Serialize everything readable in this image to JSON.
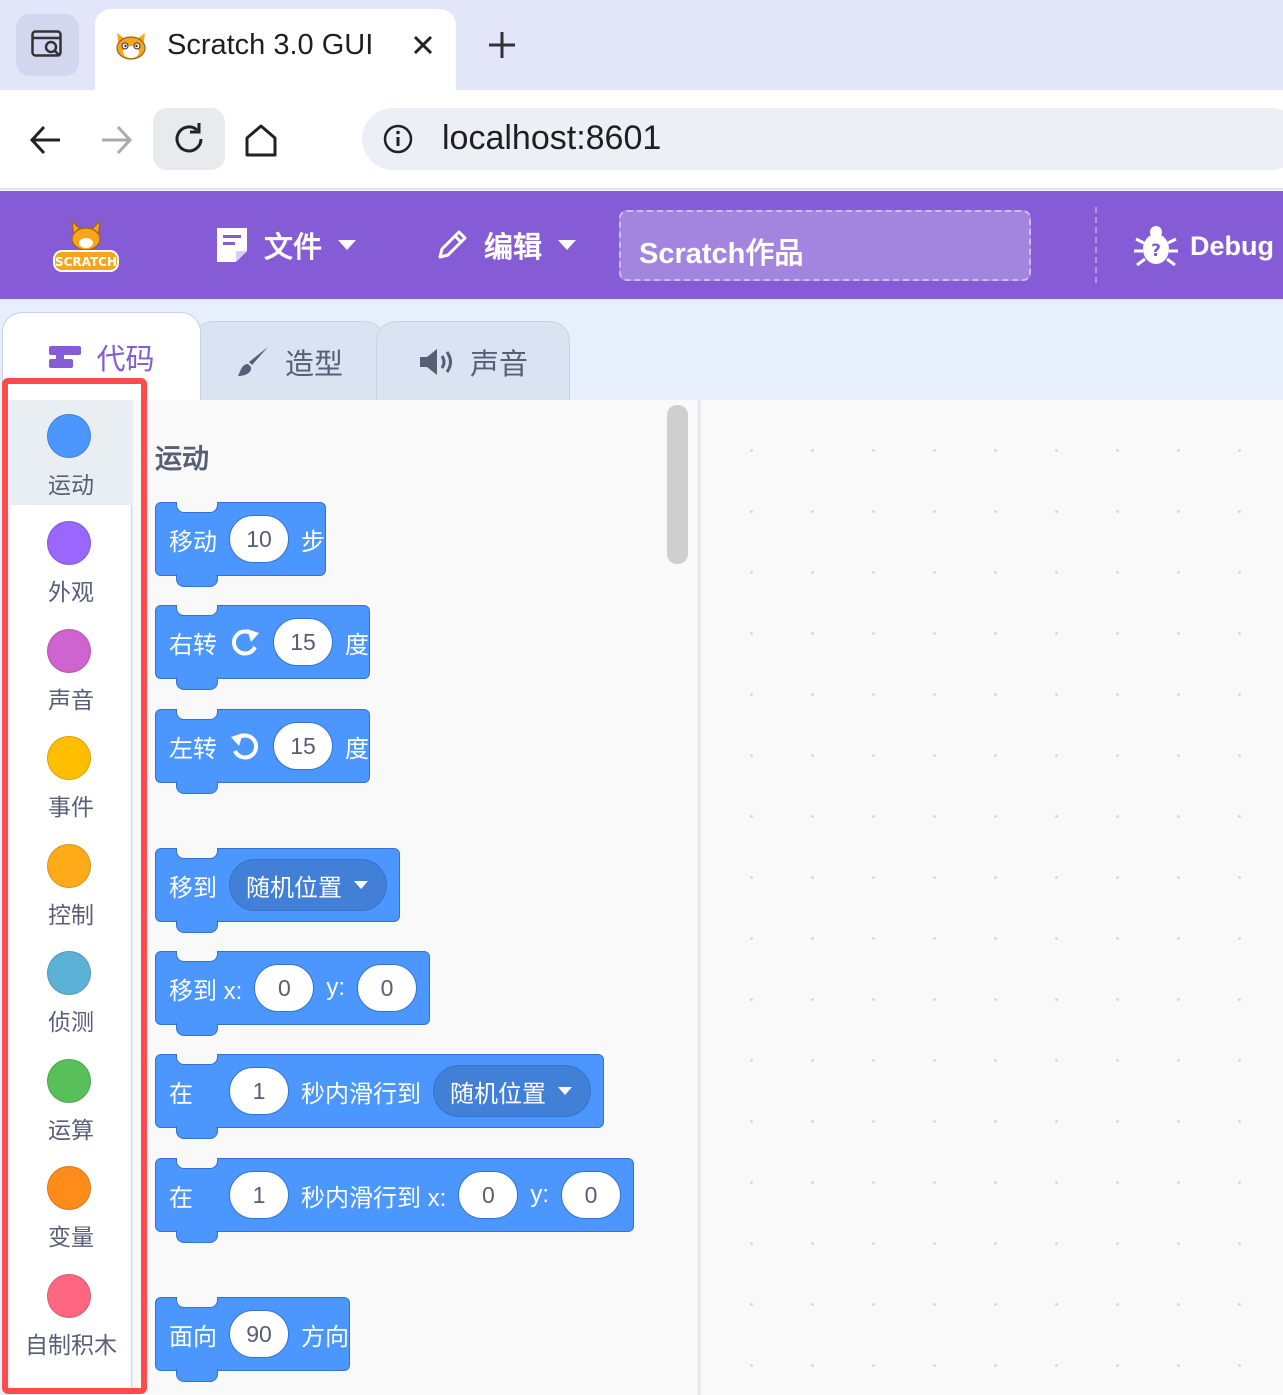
{
  "browser": {
    "tab_title": "Scratch 3.0 GUI",
    "url": "localhost:8601"
  },
  "menubar": {
    "file_label": "文件",
    "edit_label": "编辑",
    "project_title": "Scratch作品",
    "debug_label": "Debug",
    "logo_text": "SCRATCH"
  },
  "editor_tabs": [
    {
      "label": "代码",
      "active": true
    },
    {
      "label": "造型",
      "active": false
    },
    {
      "label": "声音",
      "active": false
    }
  ],
  "categories": [
    {
      "label": "运动",
      "color": "#4c97ff",
      "selected": true
    },
    {
      "label": "外观",
      "color": "#9966ff"
    },
    {
      "label": "声音",
      "color": "#cf63cf"
    },
    {
      "label": "事件",
      "color": "#ffbf00"
    },
    {
      "label": "控制",
      "color": "#ffab19"
    },
    {
      "label": "侦测",
      "color": "#5cb1d6"
    },
    {
      "label": "运算",
      "color": "#59c059"
    },
    {
      "label": "变量",
      "color": "#ff8c1a"
    },
    {
      "label": "自制积木",
      "color": "#ff6680"
    }
  ],
  "flyout": {
    "section_title": "运动",
    "blocks": {
      "move": {
        "label": "移动",
        "steps": "10",
        "suffix": "步"
      },
      "turn_right": {
        "label": "右转",
        "degrees": "15",
        "suffix": "度"
      },
      "turn_left": {
        "label": "左转",
        "degrees": "15",
        "suffix": "度"
      },
      "goto": {
        "label": "移到",
        "target": "随机位置"
      },
      "goto_xy": {
        "label": "移到 x:",
        "x": "0",
        "y_label": "y:",
        "y": "0"
      },
      "glide": {
        "label": "在",
        "secs": "1",
        "mid": "秒内滑行到",
        "target": "随机位置"
      },
      "glide_xy": {
        "label": "在",
        "secs": "1",
        "mid": "秒内滑行到 x:",
        "x": "0",
        "y_label": "y:",
        "y": "0"
      },
      "point": {
        "label": "面向",
        "direction": "90",
        "suffix": "方向"
      }
    }
  },
  "colors": {
    "menubar": "#855cd6",
    "motion": "#4c97ff",
    "highlight": "#ff4b4b"
  }
}
